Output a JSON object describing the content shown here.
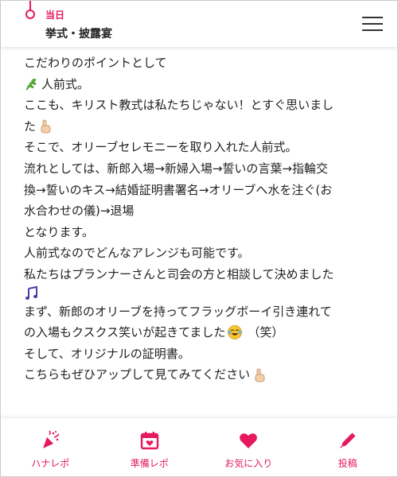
{
  "header": {
    "day_label": "当日",
    "section_title": "挙式・披露宴",
    "menu_icon": "hamburger-menu-icon"
  },
  "article": {
    "lines": [
      "こだわりのポイントとして",
      "人前式。",
      "ここも、キリスト教式は私たちじゃない！とすぐ思いまし",
      "た",
      "そこで、オリーブセレモニーを取り入れた人前式。",
      "流れとしては、新郎入場→新婦入場→誓いの言葉→指輪交",
      "換→誓いのキス→結婚証明書署名→オリーブへ水を注ぐ(お",
      "水合わせの儀)→退場",
      "となります。",
      "人前式なのでどんなアレンジも可能です。",
      "私たちはプランナーさんと司会の方と相談して決めました",
      "",
      "まず、新郎のオリーブを持ってフラッグボーイ引き連れて",
      "の入場もクスクス笑いが起きてました",
      "（笑）",
      "そして、オリジナルの証明書。",
      "こちらもぜひアップして見てみてください"
    ],
    "emoji": {
      "herb": "herb-emoji",
      "pointing": "pointing-up-emoji",
      "music": "music-notes-emoji",
      "laugh": "tears-of-joy-emoji"
    }
  },
  "nav": {
    "items": [
      {
        "label": "ハナレポ",
        "icon": "party-popper-icon"
      },
      {
        "label": "準備レポ",
        "icon": "calendar-heart-icon"
      },
      {
        "label": "お気に入り",
        "icon": "heart-icon"
      },
      {
        "label": "投稿",
        "icon": "pencil-icon"
      }
    ]
  },
  "colors": {
    "accent": "#e5195f",
    "text": "#222222",
    "background": "#ffffff"
  }
}
